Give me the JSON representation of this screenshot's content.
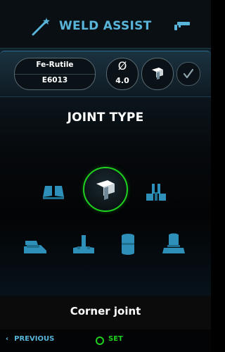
{
  "header": {
    "title": "WELD ASSIST",
    "left_icon": "magic-wand-icon",
    "right_icon": "welding-torch-icon"
  },
  "settings": {
    "material_name": "Fe-Rutile",
    "material_code": "E6013",
    "diameter_symbol": "Ø",
    "diameter_value": "4.0",
    "joint_icon": "corner-joint-icon",
    "confirm_icon": "check-icon"
  },
  "joint_type": {
    "heading": "JOINT TYPE",
    "options": [
      {
        "icon": "butt-joint-icon",
        "selected": false
      },
      {
        "icon": "corner-joint-icon",
        "selected": true
      },
      {
        "icon": "double-t-joint-icon",
        "selected": false
      },
      {
        "icon": "lap-joint-icon",
        "selected": false
      },
      {
        "icon": "t-joint-icon",
        "selected": false
      },
      {
        "icon": "pipe-butt-joint-icon",
        "selected": false
      },
      {
        "icon": "pipe-flange-joint-icon",
        "selected": false
      }
    ],
    "selected_label": "Corner joint"
  },
  "footer": {
    "previous_label": "PREVIOUS",
    "previous_icon": "chevron-left-icon",
    "set_label": "SET",
    "set_icon": "ring-icon"
  },
  "colors": {
    "accent_blue": "#58b4d8",
    "icon_blue": "#2e8fb8",
    "select_green": "#1fd11f",
    "background": "#000000"
  }
}
